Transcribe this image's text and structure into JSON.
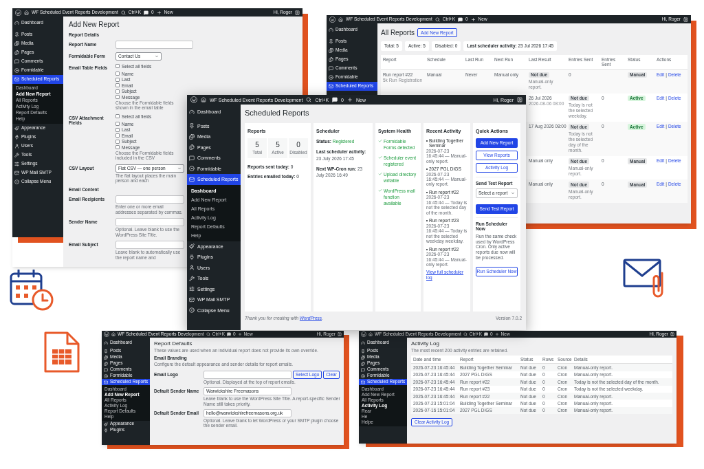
{
  "add_report_window": {
    "admin_bar": {
      "site": "WF Scheduled Event Reports Development",
      "search": "Ctrl+K",
      "comments": "0",
      "new": "New",
      "greeting": "Hi, Roger"
    },
    "menu": [
      {
        "label": "Dashboard",
        "selected": false
      },
      {
        "label": "Posts",
        "selected": false
      },
      {
        "label": "Media",
        "selected": false
      },
      {
        "label": "Pages",
        "selected": false
      },
      {
        "label": "Comments",
        "selected": false
      },
      {
        "label": "Formidable",
        "selected": false
      },
      {
        "label": "Scheduled Reports",
        "selected": true,
        "children": [
          {
            "label": "Dashboard",
            "selected": false
          },
          {
            "label": "Add New Report",
            "selected": true
          },
          {
            "label": "All Reports",
            "selected": false
          },
          {
            "label": "Activity Log",
            "selected": false
          },
          {
            "label": "Report Defaults",
            "selected": false
          },
          {
            "label": "Help",
            "selected": false
          }
        ]
      },
      {
        "label": "Appearance",
        "selected": false
      },
      {
        "label": "Plugins",
        "selected": false
      },
      {
        "label": "Users",
        "selected": false
      },
      {
        "label": "Tools",
        "selected": false
      },
      {
        "label": "Settings",
        "selected": false
      },
      {
        "label": "WP Mail SMTP",
        "selected": false
      },
      {
        "label": "Collapse Menu",
        "selected": false
      }
    ],
    "page": {
      "title": "Add New Report",
      "section": "Report Details",
      "rows": [
        {
          "kind": "input",
          "label": "Report Name"
        },
        {
          "kind": "select",
          "label": "Formidable Form",
          "value": "Contact Us"
        },
        {
          "kind": "checkboxes",
          "label": "Email Table Fields",
          "all": {
            "label": "Select all fields",
            "checked": false
          },
          "options": [
            {
              "label": "Name",
              "checked": false
            },
            {
              "label": "Last",
              "checked": false
            },
            {
              "label": "Email",
              "checked": false
            },
            {
              "label": "Subject",
              "checked": false
            },
            {
              "label": "Message",
              "checked": false
            }
          ],
          "help": "Choose the Formidable fields shown in the email table"
        },
        {
          "kind": "checkboxes",
          "label": "CSV Attachment Fields",
          "all": {
            "label": "Select all fields",
            "checked": false
          },
          "options": [
            {
              "label": "Name",
              "checked": false
            },
            {
              "label": "Last",
              "checked": false
            },
            {
              "label": "Email",
              "checked": false
            },
            {
              "label": "Subject",
              "checked": false
            },
            {
              "label": "Message",
              "checked": false
            }
          ],
          "help": "Choose the Formidable fields included in the CSV"
        },
        {
          "kind": "select",
          "label": "CSV Layout",
          "value": "Flat CSV — one person",
          "help": "The flat layout places the main person and each"
        },
        {
          "kind": "heading",
          "label": "Email Content"
        },
        {
          "kind": "input",
          "label": "Email Recipients",
          "help": "Enter one or more email addresses separated by commas."
        },
        {
          "kind": "input",
          "label": "Sender Name",
          "help": "Optional. Leave blank to use the WordPress Site Title."
        },
        {
          "kind": "input",
          "label": "Email Subject",
          "help": "Leave blank to automatically use the report name and"
        }
      ]
    }
  },
  "all_reports_window": {
    "admin_bar": {
      "site": "WF Scheduled Event Reports Development",
      "search": "Ctrl+K",
      "comments": "0",
      "new": "New",
      "greeting": "Hi, Roger"
    },
    "menu": [
      {
        "label": "Dashboard",
        "selected": false
      },
      {
        "label": "Posts",
        "selected": false
      },
      {
        "label": "Media",
        "selected": false
      },
      {
        "label": "Pages",
        "selected": false
      },
      {
        "label": "Comments",
        "selected": false
      },
      {
        "label": "Formidable",
        "selected": false
      },
      {
        "label": "Scheduled Reports",
        "selected": true
      }
    ],
    "page": {
      "title": "All Reports",
      "add_button": "Add New Report",
      "stats": [
        "Total: 5",
        "Active: 5",
        "Disabled: 0",
        "**Last scheduler activity:** 23 Jul 2026 17:45"
      ],
      "table": {
        "columns": [
          "Report",
          "Schedule",
          "Last Run",
          "Next Run",
          "Last Result",
          "Entries Sent",
          "Entries Sent",
          "Status",
          "Actions"
        ],
        "rows": [
          {
            "cells": [
              {
                "kind": "text",
                "text": "Run report #22",
                "note": "5k Run Registration"
              },
              {
                "kind": "text",
                "text": "Manual"
              },
              {
                "kind": "text",
                "text": "Never"
              },
              {
                "kind": "text",
                "text": "Manual only"
              },
              {
                "kind": "badge",
                "text": "Not due",
                "note": "Manual-only report."
              },
              {
                "kind": "text",
                "text": "0"
              },
              {
                "kind": "blank"
              },
              {
                "kind": "status",
                "text": "Manual",
                "active": false
              },
              {
                "kind": "actions",
                "links": [
                  "Edit",
                  "Delete"
                ],
                "separator": "|"
              }
            ]
          },
          {
            "cells": [
              {
                "kind": "blank"
              },
              {
                "kind": "blank"
              },
              {
                "kind": "blank"
              },
              {
                "kind": "blank"
              },
              {
                "kind": "text",
                "text": "26 Jul 2026",
                "note": "2026-08-06 08:00"
              },
              {
                "kind": "badge",
                "text": "Not due",
                "note": "Today is not the selected weekday."
              },
              {
                "kind": "text",
                "text": "0"
              },
              {
                "kind": "status",
                "text": "Active",
                "active": true
              },
              {
                "kind": "actions",
                "links": [
                  "Edit",
                  "Delete"
                ],
                "separator": "|"
              }
            ]
          },
          {
            "cells": [
              {
                "kind": "blank"
              },
              {
                "kind": "blank"
              },
              {
                "kind": "blank"
              },
              {
                "kind": "blank"
              },
              {
                "kind": "text",
                "text": "17 Aug 2026 08:00"
              },
              {
                "kind": "badge",
                "text": "Not due",
                "note": "Today is not the selected day of the month."
              },
              {
                "kind": "text",
                "text": "0"
              },
              {
                "kind": "status",
                "text": "Active",
                "active": true
              },
              {
                "kind": "actions",
                "links": [
                  "Edit",
                  "Delete"
                ],
                "separator": "|"
              }
            ]
          },
          {
            "cells": [
              {
                "kind": "blank"
              },
              {
                "kind": "blank"
              },
              {
                "kind": "blank"
              },
              {
                "kind": "blank"
              },
              {
                "kind": "text",
                "text": "Manual only"
              },
              {
                "kind": "badge",
                "text": "Not due",
                "note": "Manual-only report."
              },
              {
                "kind": "text",
                "text": "0"
              },
              {
                "kind": "status",
                "text": "Manual",
                "active": false
              },
              {
                "kind": "actions",
                "links": [
                  "Edit",
                  "Delete"
                ],
                "separator": "|"
              }
            ]
          },
          {
            "cells": [
              {
                "kind": "blank"
              },
              {
                "kind": "blank"
              },
              {
                "kind": "blank"
              },
              {
                "kind": "blank"
              },
              {
                "kind": "text",
                "text": "Manual only"
              },
              {
                "kind": "badge",
                "text": "Not due",
                "note": "Manual-only report."
              },
              {
                "kind": "text",
                "text": "0"
              },
              {
                "kind": "status",
                "text": "Manual",
                "active": false
              },
              {
                "kind": "actions",
                "links": [
                  "Edit",
                  "Delete"
                ],
                "separator": "|"
              }
            ]
          }
        ]
      }
    }
  },
  "dashboard_window": {
    "admin_bar": {
      "site": "WF Scheduled Event Reports Development",
      "search": "Ctrl+K",
      "comments": "0",
      "new": "New",
      "greeting": "Hi, Roger"
    },
    "menu": [
      {
        "label": "Dashboard",
        "selected": false
      },
      {
        "label": "Posts",
        "selected": false
      },
      {
        "label": "Media",
        "selected": false
      },
      {
        "label": "Pages",
        "selected": false
      },
      {
        "label": "Comments",
        "selected": false
      },
      {
        "label": "Formidable",
        "selected": false
      },
      {
        "label": "Scheduled Reports",
        "selected": true,
        "children": [
          {
            "label": "Dashboard",
            "selected": true
          },
          {
            "label": "Add New Report",
            "selected": false
          },
          {
            "label": "All Reports",
            "selected": false
          },
          {
            "label": "Activity Log",
            "selected": false
          },
          {
            "label": "Report Defaults",
            "selected": false
          },
          {
            "label": "Help",
            "selected": false
          }
        ]
      },
      {
        "label": "Appearance",
        "selected": false
      },
      {
        "label": "Plugins",
        "selected": false
      },
      {
        "label": "Users",
        "selected": false
      },
      {
        "label": "Tools",
        "selected": false
      },
      {
        "label": "Settings",
        "selected": false
      },
      {
        "label": "WP Mail SMTP",
        "selected": false
      },
      {
        "label": "Collapse Menu",
        "selected": false
      }
    ],
    "page": {
      "title": "Scheduled Reports",
      "cards": [
        {
          "kind": "reports",
          "title": "Reports",
          "stats": [
            {
              "value": "5",
              "label": "Total"
            },
            {
              "value": "5",
              "label": "Active"
            },
            {
              "value": "0",
              "label": "Disabled"
            }
          ],
          "lines": [
            "**Reports sent today:** 0",
            "**Entries emailed today:** 0"
          ]
        },
        {
          "kind": "scheduler",
          "title": "Scheduler",
          "lines": [
            {
              "label": "Status:",
              "value": "Registered",
              "good": true
            },
            {
              "label": "Last scheduler activity:",
              "value": "23 July 2026 17:45",
              "good": false
            },
            {
              "label": "Next WP-Cron run:",
              "value": "23 July 2026 16:49",
              "good": false
            }
          ]
        },
        {
          "kind": "health",
          "title": "System Health",
          "checks": [
            {
              "text": "Formidable Forms detected",
              "ok": true
            },
            {
              "text": "Scheduler event registered",
              "ok": true
            },
            {
              "text": "Upload directory writable",
              "ok": true
            },
            {
              "text": "WordPress mail function available",
              "ok": true
            }
          ]
        },
        {
          "kind": "activity",
          "title": "Recent Activity",
          "entries": [
            {
              "title": "Building Together Seminar",
              "detail": "2026-07-23 16:45:44 — Manual-only report."
            },
            {
              "title": "2027 PGL DIGS",
              "detail": "2026-07-23 16:45:44 — Manual-only report."
            },
            {
              "title": "Run report #22",
              "detail": "2026-07-23 16:45:44 — Today is not the selected day of the month."
            },
            {
              "title": "Run report #23",
              "detail": "2026-07-23 16:45:44 — Today is not the selected weekday weekday."
            },
            {
              "title": "Run report #22",
              "detail": "2026-07-23 16:45:44 — Manual-only report."
            }
          ],
          "link": "View full scheduler log"
        },
        {
          "kind": "actions",
          "title": "Quick Actions",
          "buttons": [
            {
              "label": "Add New Report",
              "primary": true
            },
            {
              "label": "View Reports",
              "primary": false
            },
            {
              "label": "Activity Log",
              "primary": false
            }
          ],
          "test": {
            "title": "Send Test Report",
            "select": "Select a report",
            "button": {
              "label": "Send Test Report",
              "primary": true
            }
          },
          "run": {
            "title": "Run Scheduler Now",
            "text": "Run the same check used by WordPress Cron. Only active reports due now will be processed.",
            "button": {
              "label": "Run Scheduler Now",
              "primary": false
            }
          }
        }
      ],
      "footer": {
        "thanks": "Thank you for creating with",
        "link": "WordPress",
        "end": ".",
        "version": "Version 7.0.2"
      }
    }
  },
  "report_defaults_window": {
    "admin_bar": {
      "site": "WF Scheduled Event Reports Development",
      "search": "Ctrl+K",
      "comments": "0",
      "new": "New",
      "greeting": "Hi, Roger"
    },
    "menu": [
      {
        "label": "Dashboard",
        "selected": false
      },
      {
        "label": "Posts",
        "selected": false
      },
      {
        "label": "Media",
        "selected": false
      },
      {
        "label": "Pages",
        "selected": false
      },
      {
        "label": "Comments",
        "selected": false
      },
      {
        "label": "Formidable",
        "selected": false
      },
      {
        "label": "Scheduled Reports",
        "selected": true,
        "children": [
          {
            "label": "Dashboard",
            "selected": false
          },
          {
            "label": "Add New Report",
            "selected": true
          },
          {
            "label": "All Reports",
            "selected": false
          },
          {
            "label": "Activity Log",
            "selected": false
          },
          {
            "label": "Report Defaults",
            "selected": false
          },
          {
            "label": "Help",
            "selected": false
          }
        ]
      },
      {
        "label": "Appearance",
        "selected": false
      },
      {
        "label": "Plugins",
        "selected": false
      }
    ],
    "page": {
      "title": "Report Defaults",
      "intro": "These values are used when an individual report does not provide its own override.",
      "section": "Email Branding",
      "section_intro": "Configure the default appearance and sender details for report emails.",
      "rows": [
        {
          "label": "Email Logo",
          "buttons": [
            "Select Logo",
            "Clear"
          ],
          "help": "Optional. Displayed at the top of report emails."
        },
        {
          "label": "Default Sender Name",
          "value": "Warwickshire Freemasons",
          "help": "Leave blank to use the WordPress Site Title. A report-specific Sender Name still takes priority."
        },
        {
          "label": "Default Sender Email",
          "value": "hello@warwickshirefreemasons.org.uk",
          "help": "Optional. Leave blank to let WordPress or your SMTP plugin choose the sender email."
        }
      ]
    }
  },
  "activity_log_window": {
    "admin_bar": {
      "site": "WF Scheduled Event Reports Development",
      "search": "Ctrl+K",
      "comments": "0",
      "new": "New",
      "greeting": "Hi, Roger"
    },
    "menu": [
      {
        "label": "Dashboard",
        "selected": false
      },
      {
        "label": "Posts",
        "selected": false
      },
      {
        "label": "Media",
        "selected": false
      },
      {
        "label": "Pages",
        "selected": false
      },
      {
        "label": "Comments",
        "selected": false
      },
      {
        "label": "Formidable",
        "selected": false
      },
      {
        "label": "Scheduled Reports",
        "selected": true,
        "children": [
          {
            "label": "Dashboard",
            "selected": false
          },
          {
            "label": "Add New Report",
            "selected": false
          },
          {
            "label": "All Reports",
            "selected": false
          },
          {
            "label": "Activity Log",
            "selected": true
          },
          {
            "label": "Rear",
            "selected": false
          },
          {
            "label": "He",
            "selected": false
          },
          {
            "label": "Helpe",
            "selected": false
          }
        ]
      }
    ],
    "page": {
      "title": "Activity Log",
      "intro": "The most recent 200 activity entries are retained.",
      "table": {
        "columns": [
          "Date and time",
          "Report",
          "Status",
          "Rows",
          "Source",
          "Details"
        ],
        "rows": [
          [
            "2026-07-23 16:45:44",
            "Building Together Seminar",
            "Not due",
            "0",
            "Cron",
            "Manual-only report."
          ],
          [
            "2026-07-23 16:45:44",
            "2027 PGL DIGS",
            "Not due",
            "0",
            "Cron",
            "Manual-only report."
          ],
          [
            "2026-07-23 16:45:44",
            "Run report #22",
            "Not due",
            "0",
            "Cron",
            "Today is not the selected day of the month."
          ],
          [
            "2026-07-23 16:45:44",
            "Run report #23",
            "Not due",
            "0",
            "Cron",
            "Today is not the selected weekday."
          ],
          [
            "2026-07-23 16:45:44",
            "Run report #22",
            "Not due",
            "0",
            "Cron",
            "Manual-only report."
          ],
          [
            "2026-07-23 15:01:04",
            "Building Together Seminar",
            "Not due",
            "0",
            "Cron",
            "Manual-only report."
          ],
          [
            "2026-07-16 15:01:04",
            "2027 PGL DIGS",
            "Not due",
            "0",
            "Cron",
            "Manual-only report."
          ]
        ]
      },
      "button": "Clear Activity Log"
    }
  }
}
